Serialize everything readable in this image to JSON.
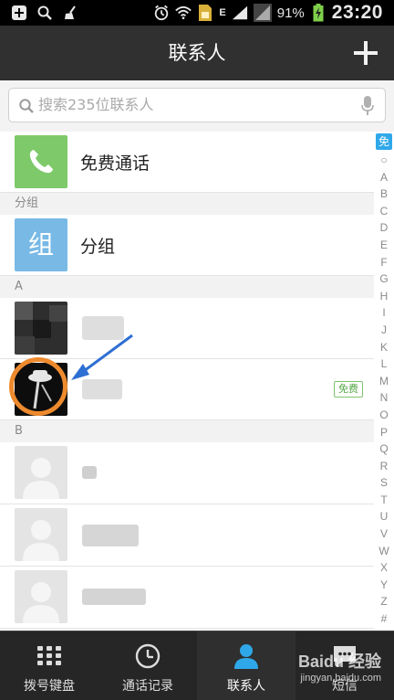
{
  "status_bar": {
    "battery": "91%",
    "time": "23:20",
    "network_label": "E",
    "icons": [
      "add-box-icon",
      "search-icon",
      "broom-icon",
      "alarm-icon",
      "wifi-icon",
      "sim-card-icon",
      "signal-icon",
      "battery-icon"
    ]
  },
  "header": {
    "title": "联系人",
    "add_icon": "plus-icon"
  },
  "search": {
    "placeholder": "搜索235位联系人",
    "icon": "search-icon",
    "mic_icon": "mic-icon"
  },
  "list": {
    "free_call": {
      "label": "免费通话",
      "icon": "phone-icon"
    },
    "groups_header": "分组",
    "groups": {
      "avatar_char": "组",
      "label": "分组"
    },
    "section_a": "A",
    "section_b": "B",
    "contacts": [
      {
        "section": "A",
        "name_hidden": true,
        "badge": ""
      },
      {
        "section": "A",
        "name_hidden": true,
        "badge": "免费",
        "highlighted": true
      },
      {
        "section": "B",
        "name_hidden": true,
        "badge": ""
      },
      {
        "section": "B",
        "name_hidden": true,
        "badge": ""
      },
      {
        "section": "B",
        "name_hidden": true,
        "badge": ""
      }
    ]
  },
  "index_bar": {
    "first": "免",
    "letters": [
      "○",
      "A",
      "B",
      "C",
      "D",
      "E",
      "F",
      "G",
      "H",
      "I",
      "J",
      "K",
      "L",
      "M",
      "N",
      "O",
      "P",
      "Q",
      "R",
      "S",
      "T",
      "U",
      "V",
      "W",
      "X",
      "Y",
      "Z",
      "#"
    ]
  },
  "tabs": [
    {
      "label": "拨号键盘",
      "icon": "dialpad-icon",
      "active": false
    },
    {
      "label": "通话记录",
      "icon": "clock-icon",
      "active": false
    },
    {
      "label": "联系人",
      "icon": "person-icon",
      "active": true
    },
    {
      "label": "短信",
      "icon": "message-icon",
      "active": false
    }
  ],
  "watermark": {
    "line1": "Baidu 经验",
    "line2": "jingyan.baidu.com"
  },
  "colors": {
    "accent": "#2fa8ea",
    "free_call_green": "#7ec96a",
    "group_blue": "#78b9e6",
    "highlight_ring": "#ee8a2e",
    "arrow": "#2e6fd3"
  }
}
